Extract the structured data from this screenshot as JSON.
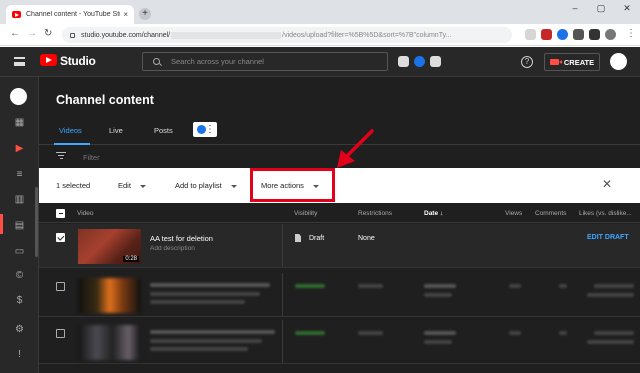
{
  "browser": {
    "tab_title": "Channel content - YouTube Studio",
    "tab_close": "×",
    "new_tab": "+",
    "window_controls": [
      "‒",
      "▢",
      "✕"
    ],
    "url_prefix": "studio.youtube.com/channel/",
    "url_suffix": "/videos/upload?filter=%5B%5D&sort=%7B\"columnTy..."
  },
  "header": {
    "logo_text": "Studio",
    "search_placeholder": "Search across your channel",
    "help": "?",
    "create_label": "CREATE"
  },
  "nav": {
    "icons": [
      "dashboard-icon",
      "content-icon",
      "playlists-icon",
      "analytics-icon",
      "comments-icon",
      "subtitles-icon",
      "copyright-icon",
      "earn-icon",
      "settings-icon",
      "feedback-icon"
    ],
    "active": "content-icon"
  },
  "page": {
    "title": "Channel content",
    "tabs": [
      "Videos",
      "Live",
      "Posts"
    ],
    "active_tab": "Videos",
    "filter_placeholder": "Filter"
  },
  "actionbar": {
    "selected": "1 selected",
    "edit": "Edit",
    "add_to_playlist": "Add to playlist",
    "more_actions": "More actions",
    "close": "✕"
  },
  "table": {
    "columns": [
      "Video",
      "Visibility",
      "Restrictions",
      "Date ↓",
      "Views",
      "Comments",
      "Likes (vs. dislike..."
    ],
    "rows": [
      {
        "title": "AA test for deletion",
        "description": "Add description",
        "duration": "0:28",
        "visibility": "Draft",
        "restrictions": "None",
        "action": "EDIT DRAFT",
        "checked": true
      }
    ]
  },
  "colors": {
    "accent_blue": "#3ea6ff",
    "brand_red": "#ff0000",
    "highlight_red": "#e3001b"
  }
}
